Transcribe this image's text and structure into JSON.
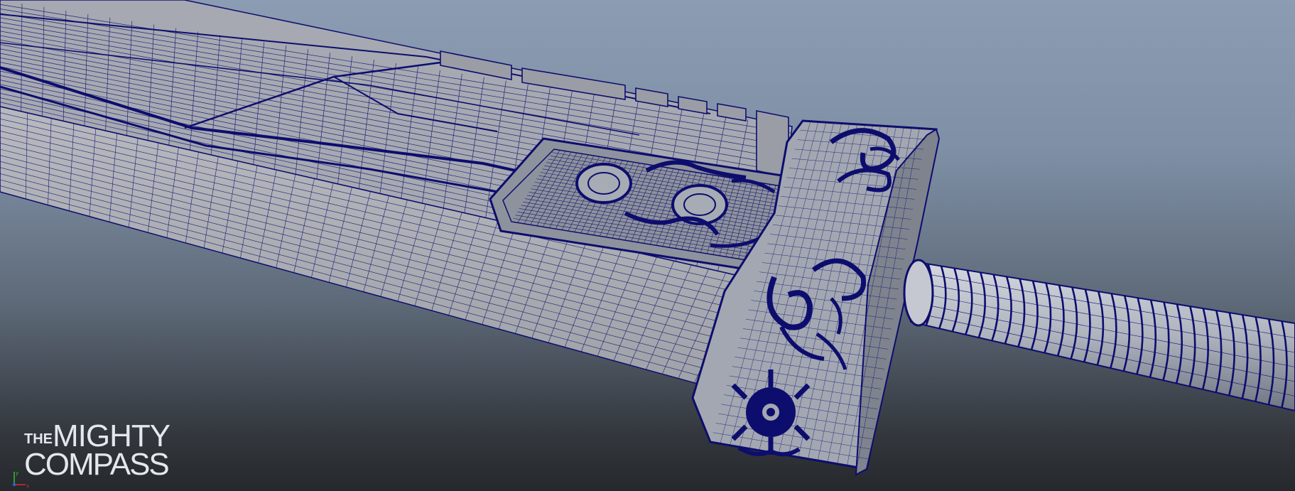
{
  "viewport": {
    "background_top": "#8b9cb3",
    "background_bottom": "#25282c",
    "wire_color": "#0d0d6e",
    "surface_color": "#a9acb3"
  },
  "model": {
    "subject": "sword",
    "display_mode": "wireframe-on-shaded"
  },
  "watermark": {
    "line1_small": "THE",
    "line1_large": "MIGHTY",
    "line2": "COMPASS",
    "color": "#e4e7ec"
  },
  "axis_gizmo": {
    "x_label": "x",
    "y_label": "y",
    "x_color": "#d03030",
    "y_color": "#35c035",
    "z_color": "#3a5ad8"
  }
}
